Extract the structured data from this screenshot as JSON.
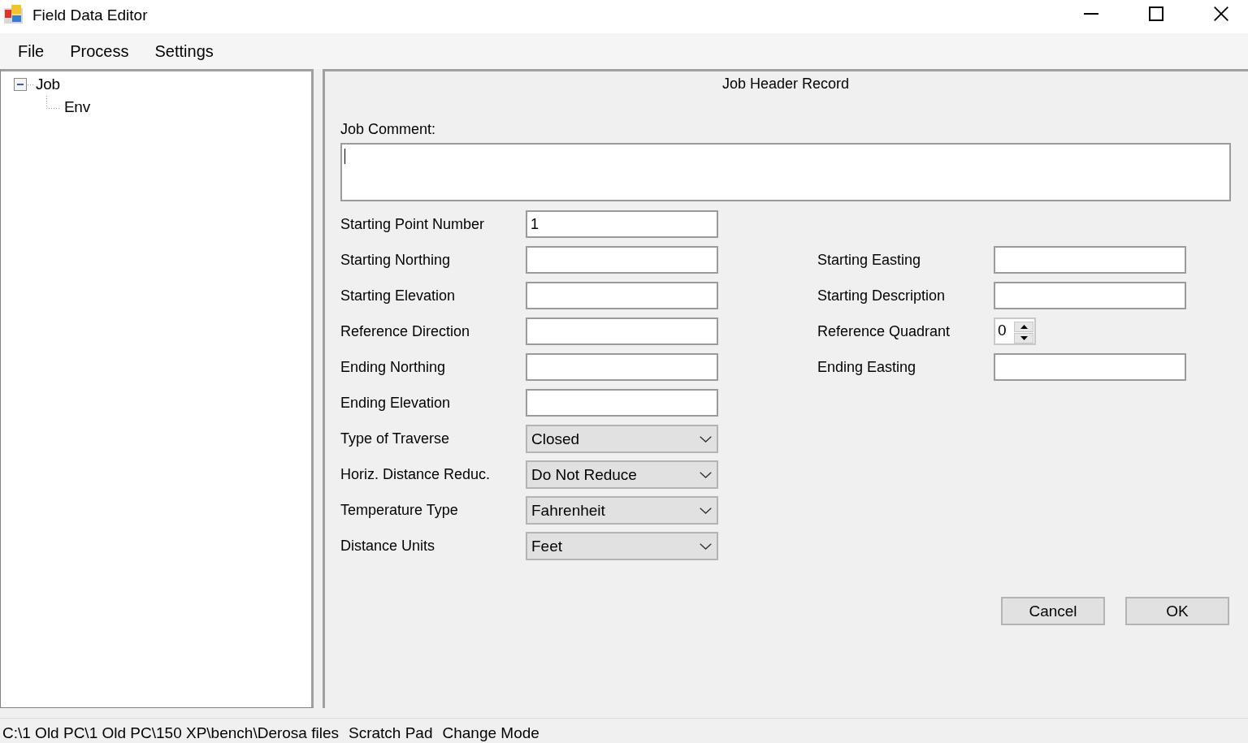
{
  "window": {
    "title": "Field Data Editor"
  },
  "menu": [
    {
      "label": "File"
    },
    {
      "label": "Process"
    },
    {
      "label": "Settings"
    }
  ],
  "tree": [
    {
      "label": "Job",
      "expanded": true,
      "children": [
        {
          "label": "Env"
        }
      ]
    }
  ],
  "form": {
    "title": "Job Header Record",
    "comment": {
      "label": "Job Comment:",
      "focused": true
    },
    "rows": [
      {
        "left": {
          "kind": "text",
          "label": "Starting Point Number",
          "value": "1"
        }
      },
      {
        "left": {
          "kind": "text",
          "label": "Starting Northing"
        },
        "right": {
          "kind": "text",
          "label": "Starting Easting"
        }
      },
      {
        "left": {
          "kind": "text",
          "label": "Starting Elevation"
        },
        "right": {
          "kind": "text",
          "label": "Starting Description"
        }
      },
      {
        "left": {
          "kind": "text",
          "label": "Reference Direction"
        },
        "right": {
          "kind": "spinner",
          "label": "Reference Quadrant",
          "value": "0"
        }
      },
      {
        "left": {
          "kind": "text",
          "label": "Ending Northing"
        },
        "right": {
          "kind": "text",
          "label": "Ending Easting"
        }
      },
      {
        "left": {
          "kind": "text",
          "label": "Ending Elevation"
        }
      },
      {
        "left": {
          "kind": "dropdown",
          "label": "Type of Traverse",
          "value": "Closed"
        }
      },
      {
        "left": {
          "kind": "dropdown",
          "label": "Horiz. Distance Reduc.",
          "value": "Do Not Reduce"
        }
      },
      {
        "left": {
          "kind": "dropdown",
          "label": "Temperature Type",
          "value": "Fahrenheit"
        }
      },
      {
        "left": {
          "kind": "dropdown",
          "label": "Distance Units",
          "value": "Feet"
        }
      }
    ],
    "buttons": [
      {
        "label": "Cancel"
      },
      {
        "label": "OK"
      }
    ]
  },
  "status_bar": [
    {
      "text": "C:\\1 Old PC\\1 Old PC\\150 XP\\bench\\Derosa files"
    },
    {
      "text": "Scratch Pad"
    },
    {
      "text": "Change Mode"
    }
  ]
}
